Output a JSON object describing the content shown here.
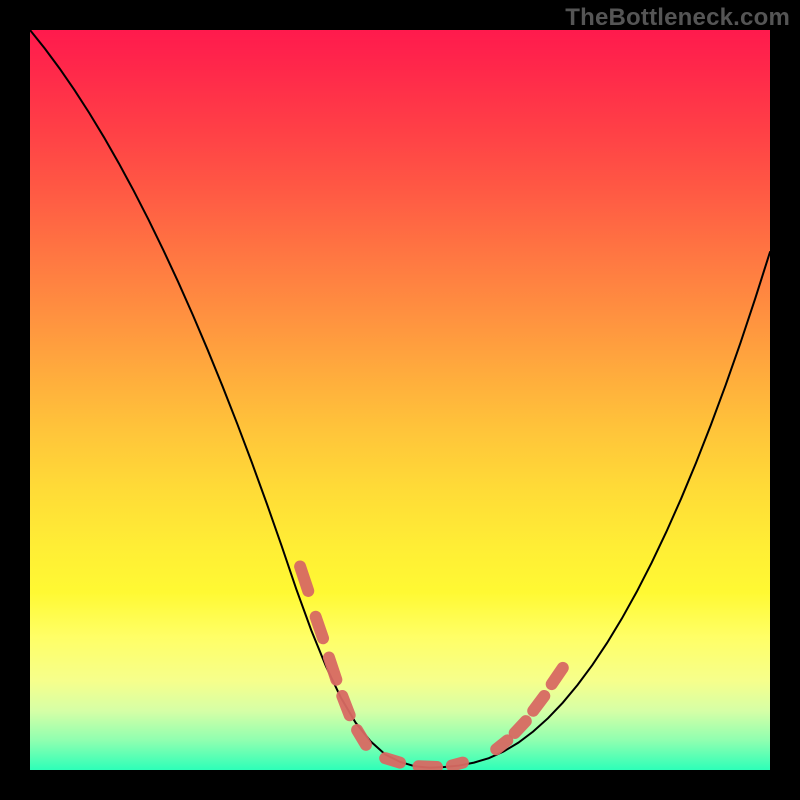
{
  "watermark": "TheBottleneck.com",
  "colors": {
    "curve": "#000000",
    "dash": "#d86a63",
    "frame": "#000000"
  },
  "chart_data": {
    "type": "line",
    "title": "",
    "xlabel": "",
    "ylabel": "",
    "xlim": [
      0,
      100
    ],
    "ylim": [
      0,
      100
    ],
    "x": [
      0,
      2,
      4,
      6,
      8,
      10,
      12,
      14,
      16,
      18,
      20,
      22,
      24,
      26,
      28,
      30,
      32,
      34,
      36,
      38,
      40,
      42,
      44,
      46,
      48,
      50,
      52,
      54,
      56,
      58,
      60,
      62,
      64,
      66,
      68,
      70,
      72,
      74,
      76,
      78,
      80,
      82,
      84,
      86,
      88,
      90,
      92,
      94,
      96,
      98,
      100
    ],
    "values": [
      100,
      97.5,
      94.8,
      91.9,
      88.8,
      85.5,
      82.0,
      78.3,
      74.4,
      70.3,
      66.0,
      61.5,
      56.8,
      51.9,
      46.8,
      41.5,
      36.0,
      30.3,
      24.4,
      18.9,
      14.0,
      9.8,
      6.4,
      3.9,
      2.1,
      1.1,
      0.5,
      0.3,
      0.4,
      0.6,
      1.0,
      1.6,
      2.5,
      3.7,
      5.2,
      7.0,
      9.1,
      11.5,
      14.2,
      17.2,
      20.5,
      24.1,
      28.0,
      32.2,
      36.7,
      41.5,
      46.6,
      52.0,
      57.7,
      63.7,
      70.0
    ],
    "dash_segments": [
      {
        "x0": 36.5,
        "y0": 27.5,
        "x1": 37.6,
        "y1": 24.2
      },
      {
        "x0": 38.6,
        "y0": 20.7,
        "x1": 39.6,
        "y1": 17.8
      },
      {
        "x0": 40.4,
        "y0": 15.2,
        "x1": 41.4,
        "y1": 12.2
      },
      {
        "x0": 42.2,
        "y0": 10.0,
        "x1": 43.2,
        "y1": 7.4
      },
      {
        "x0": 44.2,
        "y0": 5.4,
        "x1": 45.4,
        "y1": 3.4
      },
      {
        "x0": 48.0,
        "y0": 1.6,
        "x1": 50.0,
        "y1": 1.0
      },
      {
        "x0": 52.5,
        "y0": 0.5,
        "x1": 55.0,
        "y1": 0.4
      },
      {
        "x0": 57.0,
        "y0": 0.6,
        "x1": 58.5,
        "y1": 1.0
      },
      {
        "x0": 63.0,
        "y0": 2.8,
        "x1": 64.5,
        "y1": 4.0
      },
      {
        "x0": 65.5,
        "y0": 5.0,
        "x1": 67.0,
        "y1": 6.6
      },
      {
        "x0": 68.0,
        "y0": 8.0,
        "x1": 69.5,
        "y1": 10.0
      },
      {
        "x0": 70.5,
        "y0": 11.6,
        "x1": 72.0,
        "y1": 13.8
      }
    ]
  }
}
